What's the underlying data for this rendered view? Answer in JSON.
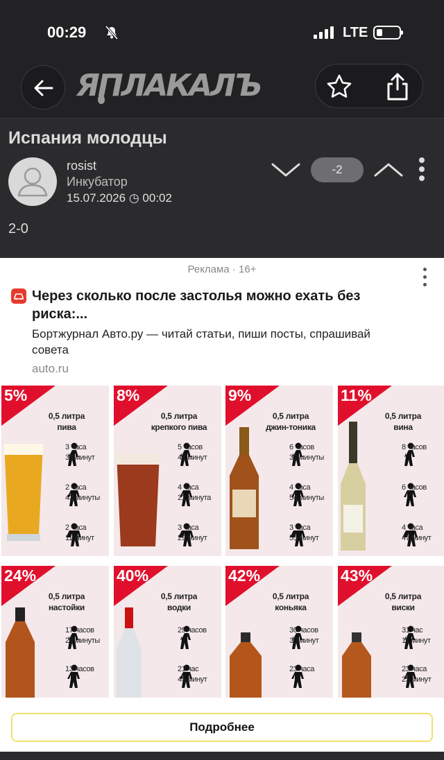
{
  "status": {
    "time": "00:29",
    "network": "LTE"
  },
  "header": {
    "logo": "ЯПЛАКАЛЪ"
  },
  "post": {
    "title": "Испания молодцы",
    "author": "rosist",
    "rank": "Инкубатор",
    "date": "15.07.2026",
    "time": "00:02",
    "score": "-2",
    "text": "2-0"
  },
  "ad": {
    "label": "Реклама · 16+",
    "title": "Через сколько после застолья можно ехать без риска:...",
    "subtitle": "Бортжурнал Авто.ру — читай статьи, пиши посты, спрашивай совета",
    "domain": "auto.ru",
    "button": "Подробнее",
    "brand_color": "#e53b2e"
  },
  "infographic": {
    "accent": "#e0102d",
    "cards": [
      {
        "percent": "5%",
        "drink": "0,5 литра\nпива",
        "times": [
          "3 часа\n38 минут",
          "2 часа\n43 минуты",
          "2 часа\n11 минут"
        ],
        "bottle": "beer-glass"
      },
      {
        "percent": "8%",
        "drink": "0,5 литра\nкрепкого пива",
        "times": [
          "5 часов\n48 минут",
          "4 часа\n21 минута",
          "3 часа\n29 минут"
        ],
        "bottle": "dark-beer-glass"
      },
      {
        "percent": "9%",
        "drink": "0,5 литра\nджин-тоника",
        "times": [
          "6 часов\n32 минуты",
          "4 часа\n54 минуты",
          "3 часа\n55 минут"
        ],
        "bottle": "brown-bottle"
      },
      {
        "percent": "11%",
        "drink": "0,5 литра\nвина",
        "times": [
          "8 часов",
          "6 часов",
          "4 часа\n47 минут"
        ],
        "bottle": "wine-bottle"
      },
      {
        "percent": "24%",
        "drink": "0,5 литра\nнастойки",
        "times": [
          "17 часов\n24 минуты",
          "13 часов"
        ],
        "bottle": "liqueur-bottle"
      },
      {
        "percent": "40%",
        "drink": "0,5 литра\nводки",
        "times": [
          "29 часов",
          "21 час\n45 минут"
        ],
        "bottle": "vodka-bottle"
      },
      {
        "percent": "42%",
        "drink": "0,5 литра\nконьяка",
        "times": [
          "30 часов\n30 минут",
          "23 часа"
        ],
        "bottle": "cognac-bottle"
      },
      {
        "percent": "43%",
        "drink": "0,5 литра\nвиски",
        "times": [
          "31 час\n11 минут",
          "23 часа\n25 минут"
        ],
        "bottle": "whisky-bottle"
      }
    ]
  }
}
